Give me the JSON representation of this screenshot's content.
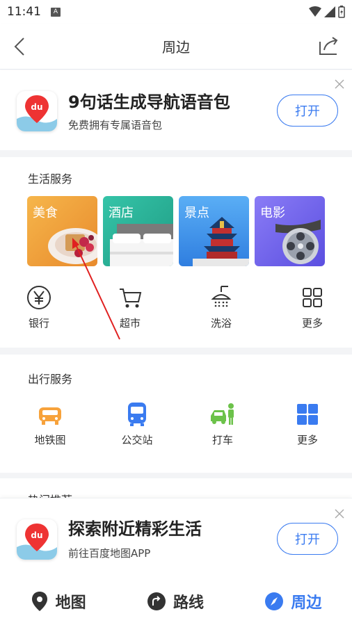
{
  "status": {
    "time": "11:41",
    "notif": "A"
  },
  "nav": {
    "title": "周边"
  },
  "banner_top": {
    "title": "9句话生成导航语音包",
    "subtitle": "免费拥有专属语音包",
    "button": "打开",
    "logo_text": "du"
  },
  "life": {
    "title": "生活服务",
    "tiles": [
      {
        "label": "美食",
        "color": "#f2a33a"
      },
      {
        "label": "酒店",
        "color": "#2cb39a"
      },
      {
        "label": "景点",
        "color": "#3d8ef0"
      },
      {
        "label": "电影",
        "color": "#7a6cf0"
      }
    ],
    "icons": [
      {
        "label": "银行",
        "icon": "yen-icon"
      },
      {
        "label": "超市",
        "icon": "cart-icon"
      },
      {
        "label": "洗浴",
        "icon": "shower-icon"
      },
      {
        "label": "更多",
        "icon": "grid-icon"
      }
    ]
  },
  "travel": {
    "title": "出行服务",
    "icons": [
      {
        "label": "地铁图",
        "icon": "subway-car-icon",
        "color": "#f7a23b"
      },
      {
        "label": "公交站",
        "icon": "bus-icon",
        "color": "#3a7bf0"
      },
      {
        "label": "打车",
        "icon": "taxi-icon",
        "color": "#6cc24a"
      },
      {
        "label": "更多",
        "icon": "grid-icon",
        "color": "#3a7bf0"
      }
    ]
  },
  "hot": {
    "title": "热门推荐"
  },
  "banner_bottom": {
    "title": "探索附近精彩生活",
    "subtitle": "前往百度地图APP",
    "button": "打开",
    "logo_text": "du"
  },
  "tabs": [
    {
      "label": "地图",
      "icon": "location-pin-icon",
      "active": false
    },
    {
      "label": "路线",
      "icon": "route-icon",
      "active": false
    },
    {
      "label": "周边",
      "icon": "compass-icon",
      "active": true
    }
  ],
  "colors": {
    "accent": "#3a7bf0",
    "annotation": "#e02020"
  }
}
